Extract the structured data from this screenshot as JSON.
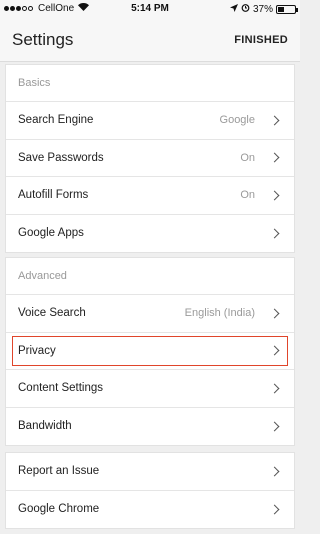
{
  "status_bar": {
    "carrier": "CellOne",
    "time": "5:14 PM",
    "battery_percent": "37%",
    "battery_level": 0.37
  },
  "header": {
    "title": "Settings",
    "finished_label": "FINISHED"
  },
  "basics": {
    "header": "Basics",
    "items": [
      {
        "label": "Search Engine",
        "value": "Google"
      },
      {
        "label": "Save Passwords",
        "value": "On"
      },
      {
        "label": "Autofill Forms",
        "value": "On"
      },
      {
        "label": "Google Apps",
        "value": ""
      }
    ]
  },
  "advanced": {
    "header": "Advanced",
    "items": [
      {
        "label": "Voice Search",
        "value": "English (India)"
      },
      {
        "label": "Privacy",
        "value": "",
        "highlighted": true
      },
      {
        "label": "Content Settings",
        "value": ""
      },
      {
        "label": "Bandwidth",
        "value": ""
      }
    ]
  },
  "more": {
    "items": [
      {
        "label": "Report an Issue",
        "value": ""
      },
      {
        "label": "Google Chrome",
        "value": ""
      }
    ]
  },
  "colors": {
    "highlight": "#e0452b",
    "background": "#efefef"
  },
  "icons": {
    "chevron": "chevron-right-icon",
    "wifi": "wifi-icon",
    "alarm": "alarm-icon",
    "location": "location-icon",
    "battery": "battery-icon"
  }
}
